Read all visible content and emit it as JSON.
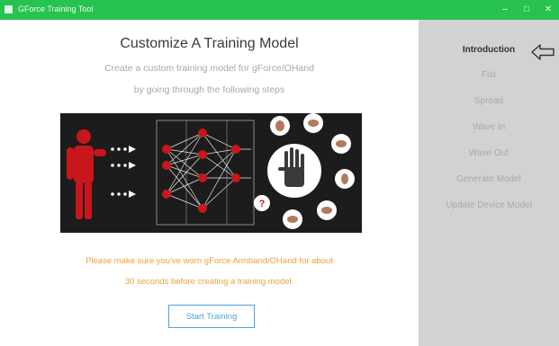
{
  "window": {
    "title": "GForce Training Tool",
    "minimize": "–",
    "maximize": "□",
    "close": "✕"
  },
  "main": {
    "heading": "Customize A Training Model",
    "subtitle_line1": "Create a custom training model for gForce/OHand",
    "subtitle_line2": "by going through the following steps",
    "notice_line1": "Please make sure you've worn gForce Armband/OHand for about",
    "notice_line2": "30 seconds before creating a training model.",
    "start_button": "Start Training",
    "illustration_question": "?"
  },
  "sidebar": {
    "steps": [
      {
        "label": "Introduction",
        "active": true
      },
      {
        "label": "Fist",
        "active": false
      },
      {
        "label": "Spread",
        "active": false
      },
      {
        "label": "Wave In",
        "active": false
      },
      {
        "label": "Wave Out",
        "active": false
      },
      {
        "label": "Generate Model",
        "active": false
      },
      {
        "label": "Update Device Model",
        "active": false
      }
    ],
    "back_icon": "back-arrow-icon"
  },
  "colors": {
    "titlebar": "#27c24f",
    "accent_blue": "#4aa3df",
    "warning_orange": "#e8a33a",
    "sidebar_bg": "#d2d2d2",
    "illustration_red": "#c8161d",
    "illustration_bg": "#1c1c1c"
  }
}
